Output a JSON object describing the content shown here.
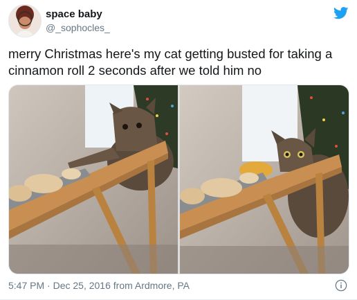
{
  "user": {
    "display_name": "space baby",
    "handle": "@_sophocles_",
    "avatar_icon": "user-avatar"
  },
  "tweet": {
    "text": "merry Christmas here's my cat getting busted for taking a cinnamon roll 2 seconds after we told him no"
  },
  "media": {
    "photo_count": 2,
    "photos": [
      "cat-photo-1",
      "cat-photo-2"
    ]
  },
  "footer": {
    "time": "5:47 PM",
    "separator": " · ",
    "date": "Dec 25, 2016",
    "location": " from Ardmore, PA"
  },
  "icons": {
    "brand": "twitter-bird-icon",
    "info": "info-icon"
  },
  "colors": {
    "twitter_blue": "#1da1f2",
    "text": "#14171a",
    "secondary_text": "#657786"
  }
}
